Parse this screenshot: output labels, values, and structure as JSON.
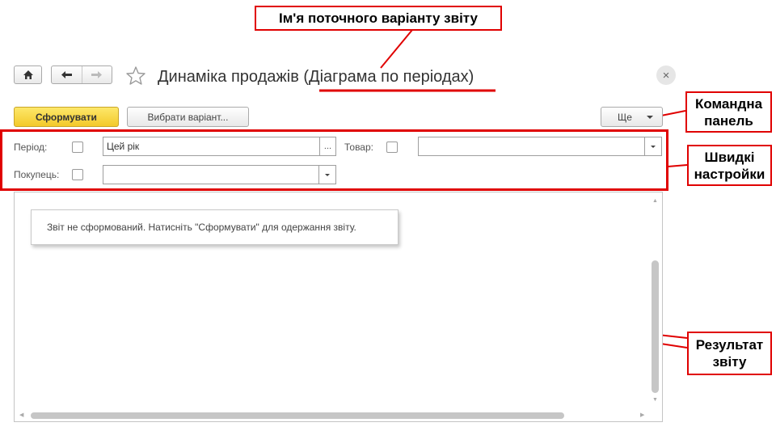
{
  "window": {
    "title": "Динаміка продажів (Діаграма по періодах)",
    "close_glyph": "×"
  },
  "icons": {
    "home": "home-icon",
    "back": "arrow-left-icon",
    "forward": "arrow-right-icon",
    "favorite": "star-icon",
    "close": "close-icon"
  },
  "toolbar": {
    "generate_label": "Сформувати",
    "choose_variant_label": "Вибрати варіант...",
    "more_label": "Ще"
  },
  "quick_settings": {
    "period_label": "Період:",
    "period_value": "Цей рік",
    "period_select_glyph": "...",
    "product_label": "Товар:",
    "product_value": "",
    "buyer_label": "Покупець:",
    "buyer_value": ""
  },
  "result": {
    "notice": "Звіт не сформований. Натисніть \"Сформувати\" для одержання звіту."
  },
  "annotations": {
    "variant_name": "Ім'я поточного варіанту звіту",
    "command_panel": "Командна панель",
    "quick_settings": "Швидкі настройки",
    "report_result": "Результат звіту"
  },
  "colors": {
    "annotation_red": "#e00000",
    "primary_button": "#f6d33a"
  }
}
